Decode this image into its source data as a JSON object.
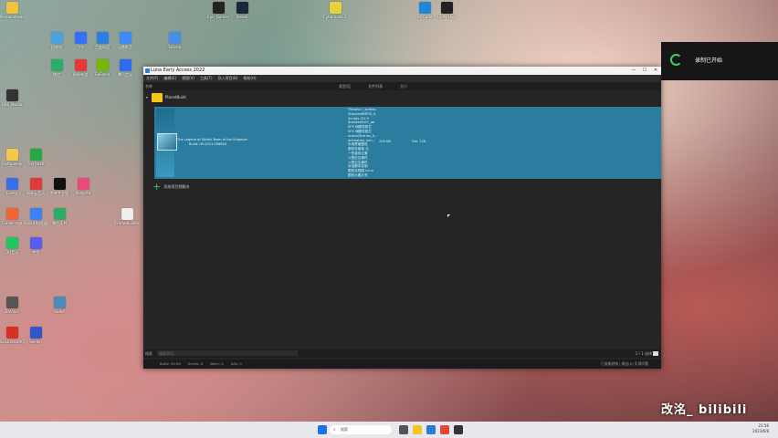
{
  "desktop": {
    "icons": [
      {
        "label": "Personalreward",
        "color": "#f0c33c"
      },
      {
        "label": "回收站",
        "color": "#4da3e0"
      },
      {
        "label": "飞书",
        "color": "#3370ff"
      },
      {
        "label": "百度网盘",
        "color": "#2f7de1"
      },
      {
        "label": "迅雷影音",
        "color": "#3b8cf5"
      },
      {
        "label": "微信",
        "color": "#2aae67"
      },
      {
        "label": "网易有道",
        "color": "#e53935"
      },
      {
        "label": "GeForce",
        "color": "#76b900"
      },
      {
        "label": "腾讯会议",
        "color": "#2e6bf2"
      },
      {
        "label": "OBS Studio",
        "color": "#333333"
      },
      {
        "label": "ToDesk",
        "color": "#4a8fe7"
      },
      {
        "label": "Epic Games",
        "color": "#222222"
      },
      {
        "label": "Steam",
        "color": "#1b2838"
      },
      {
        "label": "Cyberpunk 2077",
        "color": "#e8d13a"
      },
      {
        "label": "VS Code",
        "color": "#1f87d6"
      },
      {
        "label": "Unity Hub",
        "color": "#222222"
      },
      {
        "label": "FastSpeedo",
        "color": "#f2c94c"
      },
      {
        "label": "TextFetch",
        "color": "#28a745"
      },
      {
        "label": "Lively",
        "color": "#3a6ee8"
      },
      {
        "label": "网易云音乐",
        "color": "#e03b3b"
      },
      {
        "label": "剪映专业版",
        "color": "#111111"
      },
      {
        "label": "Aseprite",
        "color": "#e84a7a"
      },
      {
        "label": "微信读书",
        "color": "#2aae67"
      },
      {
        "label": "网易UU加速器",
        "color": "#3b82f6"
      },
      {
        "label": "FrameBuilder",
        "color": "#eeeeee"
      },
      {
        "label": "CurseForge",
        "color": "#f16436"
      },
      {
        "label": "夸克",
        "color": "#5b5bf0"
      },
      {
        "label": "QQ音乐",
        "color": "#22c55e"
      },
      {
        "label": "DaVinci",
        "color": "#555555"
      },
      {
        "label": "SOLIDWORKS",
        "color": "#d93025"
      },
      {
        "label": "Seelen",
        "color": "#3355cc"
      },
      {
        "label": "Godot",
        "color": "#478cbf"
      }
    ]
  },
  "app": {
    "title": "Luna Early Access 2022",
    "window_buttons": [
      "—",
      "☐",
      "✕"
    ],
    "menu": [
      "文件(F)",
      "编辑(E)",
      "视图(V)",
      "工具(T)",
      "导入项目(B)",
      "帮助(H)"
    ],
    "sort_label": "名称",
    "columns": {
      "type": "类型/区",
      "files": "文件列表",
      "size": "大小"
    },
    "folder": {
      "name": "PlanetBuild",
      "chevron": "▾"
    },
    "selected_item": {
      "title_line1": "The Legend of Shield Team of the Kingdom",
      "title_line2": "Build: 09.2021.098800",
      "details": [
        "Tilesets+_sprites",
        "StandardRPGS_A",
        "Scripts (21.9",
        "StandardUI+_ad",
        "SFX 地图导航栏",
        "SFX 地图导航栏",
        "scene(Scenes_A...",
        "animation_lum...",
        "天地界面图设",
        "图形化面板 元",
        "一些游戏元素",
        "人物交互事件",
        "人物交互事件",
        "对话脚本控制",
        "图形化视图 Luna",
        "图形大图片夹"
      ],
      "size": "200 KB",
      "info": "File: 128"
    },
    "add_label": "添加项目到解决",
    "filter_label": "搜索",
    "filter_placeholder": "搜索项目...",
    "zoom_label": "1 / 1 选择",
    "status": {
      "left": [
        "Build: 99.99",
        "Errors: 0",
        "Warn: 0",
        "Info: 0"
      ],
      "right": "已准备就绪 | 输出(0) 反馈问题"
    }
  },
  "notification": {
    "text": "录制已开始"
  },
  "taskbar": {
    "search_placeholder": "搜索",
    "time": "21:56",
    "date": "2023/6/8"
  },
  "watermark": "改洺_ bilibili"
}
